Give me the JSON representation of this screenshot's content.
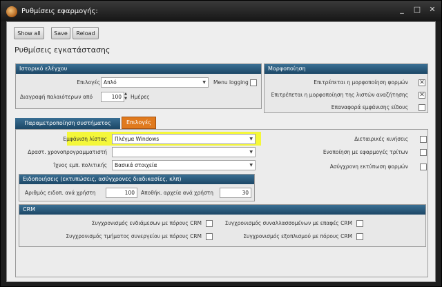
{
  "window": {
    "title": "Ρυθμίσεις εφαρμογής:",
    "controls": [
      "_",
      "□",
      "✕"
    ]
  },
  "toolbar": {
    "show_all": "Show all",
    "save": "Save",
    "reload": "Reload"
  },
  "page": {
    "title": "Ρυθμίσεις εγκατάστασης"
  },
  "history": {
    "header": "Ιστορικό ελέγχου",
    "options_label": "Επιλογές",
    "options_value": "Απλό",
    "menu_logging_label": "Menu logging",
    "menu_logging_checked": false,
    "delete_label": "Διαγραφή παλαιότερων από",
    "delete_value": "100",
    "days_label": "Ημέρες"
  },
  "formatting": {
    "header": "Μορφοποίηση",
    "items": [
      {
        "label": "Επιτρέπεται η μορφοποίηση φορμών",
        "checked": true
      },
      {
        "label": "Επιτρέπεται η μορφοποίηση της λιστών αναζήτησης",
        "checked": true
      },
      {
        "label": "Επαναφορά εμφάνισης είδους",
        "checked": false
      }
    ]
  },
  "tabs": {
    "system": "Παραμετροποίηση συστήματος",
    "options": "Επιλογές"
  },
  "options_tab": {
    "list_display_label": "Εμφάνιση λίστας",
    "list_display_value": "Πλέγμα Windows",
    "scheduler_label": "Δραστ. χρονοπρογραμματιστή",
    "scheduler_value": "",
    "policy_label": "Ίχνος εμπ. πολιτικής",
    "policy_value": "Βασικά στοιχεία",
    "right_items": [
      {
        "label": "Διεταιρικές κινήσεις",
        "checked": false
      },
      {
        "label": "Ενοποίηση με εφαρμογές τρίτων",
        "checked": false
      },
      {
        "label": "Ασύγχρονη εκτύπωση φορμών",
        "checked": false
      }
    ]
  },
  "notifications": {
    "header": "Ειδοποιήσεις (εκτυπώσεις, ασύγχρονες διαδικασίες, κλπ)",
    "per_user_label": "Αριθμός ειδοπ. ανά χρήστη",
    "per_user_value": "100",
    "files_label": "Αποθήκ. αρχεία ανά χρήστη",
    "files_value": "30"
  },
  "crm": {
    "header": "CRM",
    "left_items": [
      {
        "label": "Συγχρονισμός ενδιάμεσων με πόρους CRM",
        "checked": false
      },
      {
        "label": "Συγχρονισμός τμήματος συνεργείου με πόρους CRM",
        "checked": false
      }
    ],
    "right_items": [
      {
        "label": "Συγχρονισμός συναλλασσομένων με επαφές CRM",
        "checked": false
      },
      {
        "label": "Συγχρονισμός εξοπλισμού με πόρους CRM",
        "checked": false
      }
    ]
  },
  "colors": {
    "panel_header": "#2a5a7d",
    "tab_active": "#e07a1e",
    "highlight": "#f4f73a"
  }
}
